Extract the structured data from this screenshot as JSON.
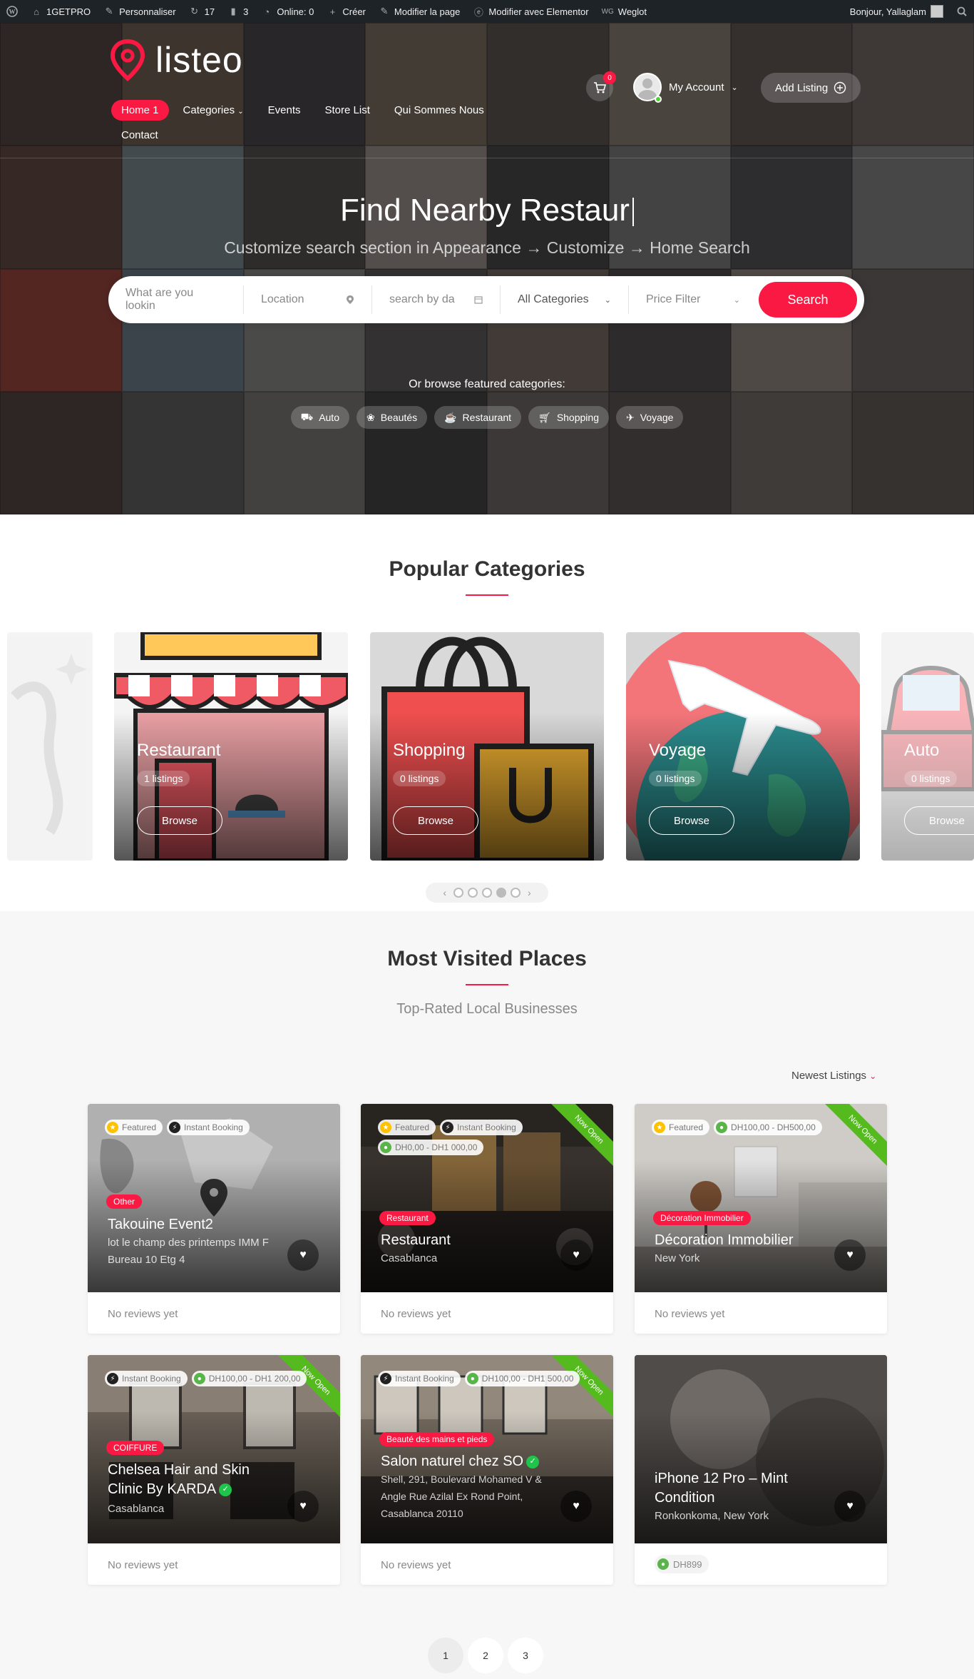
{
  "admin_bar": {
    "items": [
      {
        "label": "1GETPRO",
        "icon": "home-icon"
      },
      {
        "label": "Personnaliser",
        "icon": "brush-icon"
      },
      {
        "label": "17",
        "icon": "updates-icon"
      },
      {
        "label": "3",
        "icon": "comment-icon"
      },
      {
        "label": "Online: 0",
        "icon": "chart-icon"
      },
      {
        "label": "Créer",
        "icon": "plus-icon"
      },
      {
        "label": "Modifier la page",
        "icon": "pencil-icon"
      },
      {
        "label": "Modifier avec Elementor",
        "icon": "elementor-icon"
      },
      {
        "label": "Weglot",
        "icon": "weglot-icon"
      }
    ],
    "greeting": "Bonjour, Yallaglam"
  },
  "header": {
    "logo": "listeo",
    "nav": [
      "Home 1",
      "Categories",
      "Events",
      "Store List",
      "Qui Sommes Nous",
      "Contact"
    ],
    "cart_count": "0",
    "account_label": "My Account",
    "add_listing_label": "Add Listing"
  },
  "hero": {
    "title": "Find Nearby Restaur",
    "subtitle": "Customize search section in Appearance → Customize → Home Search",
    "search": {
      "keyword_placeholder": "What are you lookin",
      "location_placeholder": "Location",
      "date_placeholder": "search by da",
      "category_value": "All Categories",
      "price_label": "Price Filter",
      "button": "Search"
    },
    "browse_label": "Or browse featured categories:",
    "categories": [
      "Auto",
      "Beautés",
      "Restaurant",
      "Shopping",
      "Voyage"
    ]
  },
  "popular": {
    "title": "Popular Categories",
    "cards": [
      {
        "name": "Restaurant",
        "count": "1 listings",
        "browse": "Browse"
      },
      {
        "name": "Shopping",
        "count": "0 listings",
        "browse": "Browse"
      },
      {
        "name": "Voyage",
        "count": "0 listings",
        "browse": "Browse"
      },
      {
        "name": "Auto",
        "count": "0 listings",
        "browse": "Browse"
      }
    ],
    "slider_active_dot": 4,
    "slider_dot_count": 5
  },
  "most_visited": {
    "title": "Most Visited Places",
    "subtitle": "Top-Rated Local Businesses",
    "sort_label": "Newest Listings",
    "listings": [
      {
        "badges": [
          "Featured",
          "Instant Booking"
        ],
        "category": "Other",
        "title": "Takouine Event2",
        "address": "lot le champ des printemps IMM F Bureau 10 Etg 4",
        "footer": "No reviews yet"
      },
      {
        "badges": [
          "Featured",
          "Instant Booking",
          "DH0,00 - DH1 000,00"
        ],
        "ribbon": "Now Open",
        "category": "Restaurant",
        "title": "Restaurant",
        "address": "Casablanca",
        "footer": "No reviews yet"
      },
      {
        "badges": [
          "Featured",
          "DH100,00 - DH500,00"
        ],
        "ribbon": "Now Open",
        "category": "Décoration Immobilier",
        "title": "Décoration Immobilier",
        "address": "New York",
        "footer": "No reviews yet"
      },
      {
        "badges": [
          "Instant Booking",
          "DH100,00 - DH1 200,00"
        ],
        "ribbon": "Now Open",
        "category": "COIFFURE",
        "title": "Chelsea Hair and Skin Clinic By KARDA",
        "address": "Casablanca",
        "footer": "No reviews yet"
      },
      {
        "badges": [
          "Instant Booking",
          "DH100,00 - DH1 500,00"
        ],
        "ribbon": "Now Open",
        "category": "Beauté des mains et pieds",
        "title": "Salon naturel chez SO",
        "address": "Shell, 291, Boulevard Mohamed V & Angle Rue Azilal Ex Rond Point, Casablanca 20110",
        "footer": "No reviews yet"
      },
      {
        "title": "iPhone 12 Pro – Mint Condition",
        "address": "Ronkonkoma, New York",
        "price": "DH899"
      }
    ],
    "pages": [
      "1",
      "2",
      "3"
    ]
  },
  "colors": {
    "accent": "#f91942",
    "admin_bar": "#1d2327",
    "ribbon": "#54ba1d"
  }
}
